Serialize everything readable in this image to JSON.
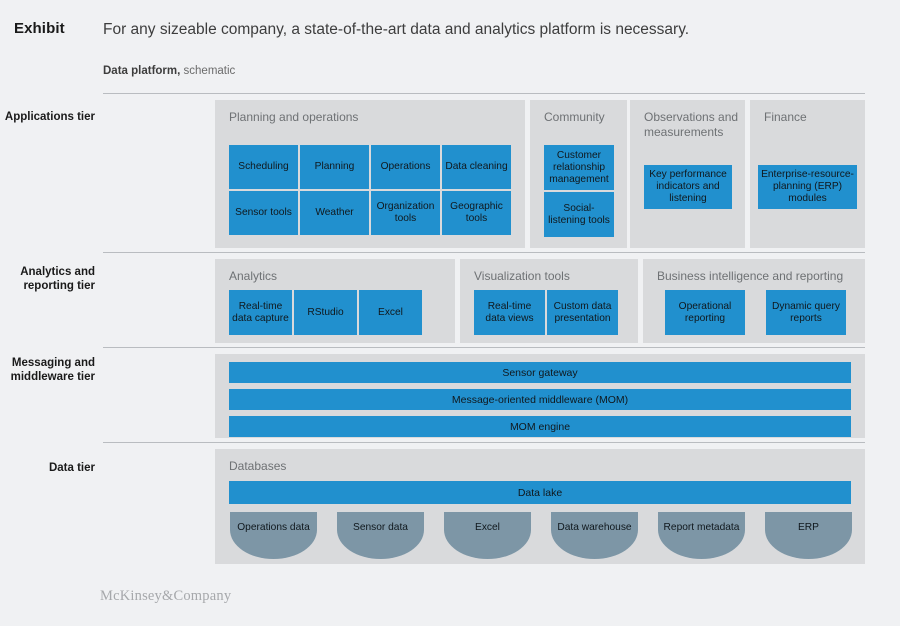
{
  "header": {
    "exhibit_label": "Exhibit",
    "headline": "For any sizeable company, a state-of-the-art data and analytics platform is necessary.",
    "subtitle_bold": "Data platform,",
    "subtitle_normal": "schematic"
  },
  "footer": {
    "logo": "McKinsey&Company"
  },
  "colors": {
    "tile_blue": "#2190ce",
    "panel_grey": "#d9dadc",
    "database_slate": "#7d96a6",
    "page_background": "#f0f1f3",
    "divider": "#b9bcc0"
  },
  "tiers": [
    {
      "label": "Applications tier",
      "panels": [
        {
          "title": "Planning and operations",
          "tiles": [
            "Scheduling",
            "Planning",
            "Operations",
            "Data cleaning",
            "Sensor tools",
            "Weather",
            "Organization tools",
            "Geographic tools"
          ]
        },
        {
          "title": "Community",
          "tiles": [
            "Customer relationship management",
            "Social-listening tools"
          ]
        },
        {
          "title": "Observations and measurements",
          "tiles": [
            "Key performance indicators and listening"
          ]
        },
        {
          "title": "Finance",
          "tiles": [
            "Enterprise-resource-planning (ERP) modules"
          ]
        }
      ]
    },
    {
      "label": "Analytics and reporting tier",
      "panels": [
        {
          "title": "Analytics",
          "tiles": [
            "Real-time data capture",
            "RStudio",
            "Excel"
          ]
        },
        {
          "title": "Visualization tools",
          "tiles": [
            "Real-time data views",
            "Custom data presentation"
          ]
        },
        {
          "title": "Business intelligence and reporting",
          "tiles": [
            "Operational reporting",
            "Dynamic query reports"
          ]
        }
      ]
    },
    {
      "label": "Messaging and middleware tier",
      "panels": [
        {
          "title": "",
          "bars": [
            "Sensor gateway",
            "Message-oriented middleware (MOM)",
            "MOM engine"
          ]
        }
      ]
    },
    {
      "label": "Data tier",
      "panels": [
        {
          "title": "Databases",
          "bars": [
            "Data lake"
          ],
          "databases": [
            "Operations data",
            "Sensor data",
            "Excel",
            "Data warehouse",
            "Report metadata",
            "ERP"
          ]
        }
      ]
    }
  ]
}
